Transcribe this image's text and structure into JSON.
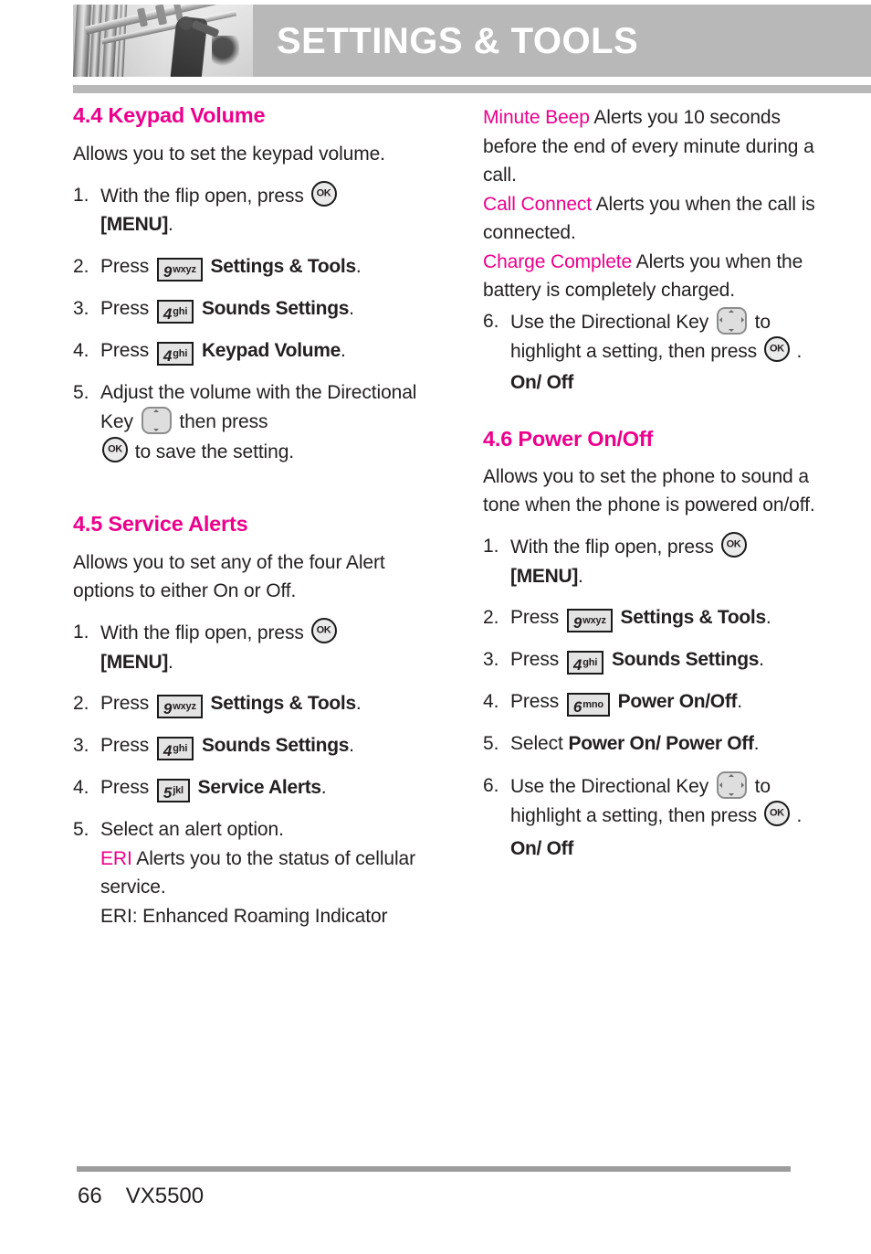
{
  "header": {
    "title": "SETTINGS & TOOLS",
    "photo_alt": "grayscale-architecture-photo"
  },
  "icons": {
    "ok": "OK",
    "key_9": {
      "digit": "9",
      "letters": "wxyz"
    },
    "key_4": {
      "digit": "4",
      "letters": "ghi"
    },
    "key_5": {
      "digit": "5",
      "letters": "jkl"
    },
    "key_6": {
      "digit": "6",
      "letters": "mno"
    }
  },
  "left_column": {
    "section_44": {
      "heading": "4.4 Keypad Volume",
      "intro": "Allows you to set the keypad volume.",
      "steps": [
        {
          "num": "1.",
          "pre": "With the flip open, press ",
          "icon": "ok",
          "post_bold": "[MENU]",
          "post": "."
        },
        {
          "num": "2.",
          "pre": "Press ",
          "icon": "key_9",
          "post_bold": "Settings & Tools",
          "post": "."
        },
        {
          "num": "3.",
          "pre": "Press ",
          "icon": "key_4",
          "post_bold": "Sounds Settings",
          "post": "."
        },
        {
          "num": "4.",
          "pre": "Press ",
          "icon": "key_4",
          "post_bold": "Keypad Volume",
          "post": "."
        },
        {
          "num": "5.",
          "pre": "Adjust the volume with the Directional Key ",
          "icon": "dir_ud",
          "mid": " then press ",
          "icon2": "ok",
          "post": " to save the setting."
        }
      ]
    },
    "section_45": {
      "heading": "4.5 Service Alerts",
      "intro": "Allows you to set any of the four Alert options to either On or Off.",
      "steps": [
        {
          "num": "1.",
          "pre": "With the flip open, press ",
          "icon": "ok",
          "post_bold": "[MENU]",
          "post": "."
        },
        {
          "num": "2.",
          "pre": "Press ",
          "icon": "key_9",
          "post_bold": "Settings & Tools",
          "post": "."
        },
        {
          "num": "3.",
          "pre": "Press ",
          "icon": "key_4",
          "post_bold": "Sounds Settings",
          "post": "."
        },
        {
          "num": "4.",
          "pre": "Press ",
          "icon": "key_5",
          "post_bold": "Service Alerts",
          "post": "."
        },
        {
          "num": "5.",
          "pre": "Select an alert option."
        }
      ],
      "alert_options": [
        {
          "name": "ERI",
          "desc": " Alerts you to the status of cellular service."
        },
        {
          "name": "",
          "desc": "ERI: Enhanced Roaming Indicator"
        }
      ]
    }
  },
  "right_column": {
    "alert_options_continued": [
      {
        "name": "Minute Beep",
        "desc": " Alerts you 10 seconds before the end of every minute during a call."
      },
      {
        "name": "Call Connect",
        "desc": " Alerts you when the call is connected."
      },
      {
        "name": "Charge Complete",
        "desc": " Alerts you when the battery is completely charged."
      }
    ],
    "step6": {
      "num": "6.",
      "pre": "Use the Directional Key ",
      "icon": "dir_4way",
      "mid": " to highlight a setting, then press ",
      "icon2": "ok",
      "post": " .",
      "result_bold": "On/ Off"
    },
    "section_46": {
      "heading": "4.6 Power On/Off",
      "intro": "Allows you to set the phone to sound a tone when the phone is powered on/off.",
      "steps": [
        {
          "num": "1.",
          "pre": "With the flip open, press ",
          "icon": "ok",
          "post_bold": "[MENU]",
          "post": "."
        },
        {
          "num": "2.",
          "pre": "Press ",
          "icon": "key_9",
          "post_bold": "Settings & Tools",
          "post": "."
        },
        {
          "num": "3.",
          "pre": "Press ",
          "icon": "key_4",
          "post_bold": "Sounds Settings",
          "post": "."
        },
        {
          "num": "4.",
          "pre": "Press ",
          "icon": "key_6",
          "post_bold": "Power On/Off",
          "post": "."
        },
        {
          "num": "5.",
          "pre": "Select ",
          "post_bold": "Power On/ Power Off",
          "post": "."
        },
        {
          "num": "6.",
          "pre": "Use the Directional Key ",
          "icon": "dir_4way",
          "mid": " to highlight a setting, then press ",
          "icon2": "ok",
          "post": " ."
        }
      ],
      "result_bold": "On/ Off"
    }
  },
  "footer": {
    "page_number": "66",
    "model": "VX5500"
  },
  "colors": {
    "accent_pink": "#ec008c",
    "header_gray": "#b8b8b8",
    "text": "#231f20",
    "keycap_fill": "#e3e3e3",
    "dirkey_fill": "#dedede"
  }
}
